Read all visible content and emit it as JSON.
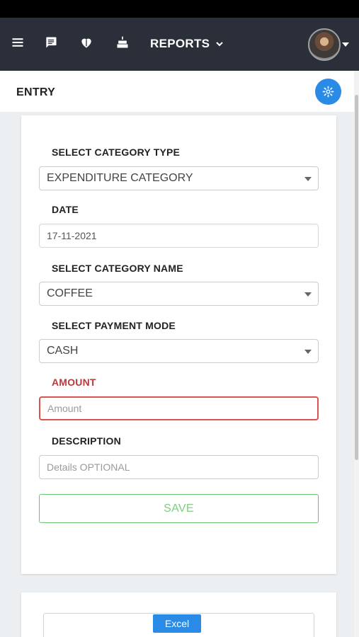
{
  "navbar": {
    "reports_label": "REPORTS",
    "icons": [
      "menu-icon",
      "chat-icon",
      "heart-icon",
      "cake-icon"
    ]
  },
  "subheader": {
    "title": "ENTRY"
  },
  "form": {
    "category_type_label": "SELECT CATEGORY TYPE",
    "category_type_value": "EXPENDITURE CATEGORY",
    "date_label": "DATE",
    "date_value": "17-11-2021",
    "category_name_label": "SELECT CATEGORY NAME",
    "category_name_value": "COFFEE",
    "payment_mode_label": "SELECT PAYMENT MODE",
    "payment_mode_value": "CASH",
    "amount_label": "AMOUNT",
    "amount_placeholder": "Amount",
    "description_label": "DESCRIPTION",
    "description_placeholder": "Details OPTIONAL",
    "save_label": "SAVE"
  },
  "report": {
    "excel_label": "Excel"
  },
  "colors": {
    "navbar": "#2b2f3a",
    "accent": "#2a8be6",
    "error": "#d9534f",
    "success": "#6cc56c"
  }
}
